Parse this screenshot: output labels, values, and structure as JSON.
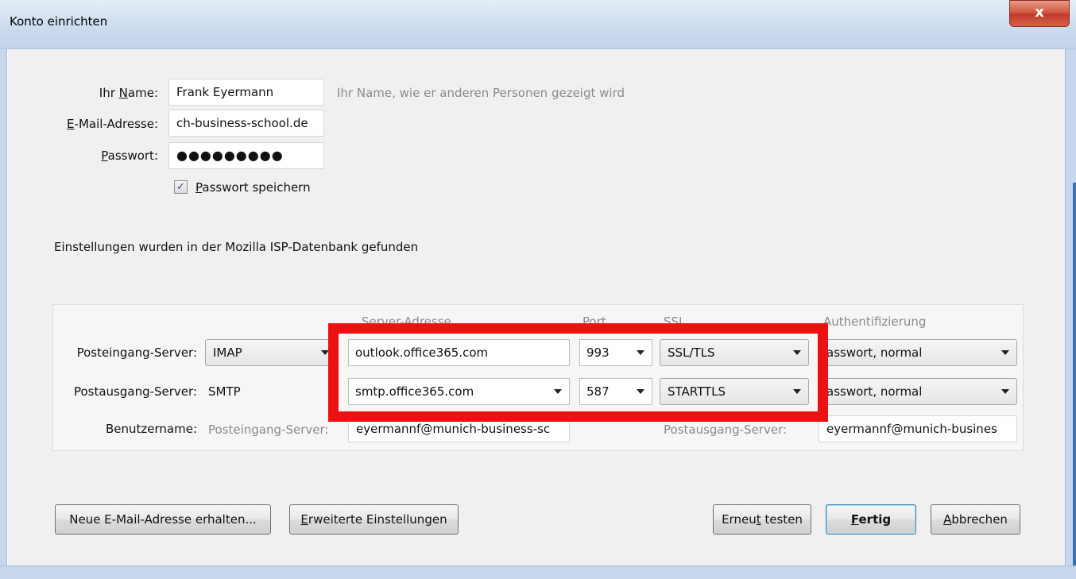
{
  "window": {
    "title": "Konto einrichten",
    "close_glyph": "x"
  },
  "form": {
    "name_label_pre": "Ihr ",
    "name_label_ul": "N",
    "name_label_post": "ame:",
    "name_value": "Frank Eyermann",
    "name_hint": "Ihr Name, wie er anderen Personen gezeigt wird",
    "email_label_ul": "E",
    "email_label_post": "-Mail-Adresse:",
    "email_value": "ch-business-school.de",
    "password_label_ul": "P",
    "password_label_post": "asswort:",
    "password_value": "●●●●●●●●●",
    "save_password_checked": true,
    "save_password_ul": "P",
    "save_password_post": "asswort speichern"
  },
  "status_message": "Einstellungen wurden in der Mozilla ISP-Datenbank gefunden",
  "server_table": {
    "headers": {
      "server_address": "Server-Adresse",
      "port": "Port",
      "ssl": "SSL",
      "auth": "Authentifizierung"
    },
    "incoming": {
      "label": "Posteingang-Server:",
      "protocol": "IMAP",
      "hostname": "outlook.office365.com",
      "port": "993",
      "ssl": "SSL/TLS",
      "auth": "asswort, normal"
    },
    "outgoing": {
      "label": "Postausgang-Server:",
      "protocol": "SMTP",
      "hostname": "smtp.office365.com",
      "port": "587",
      "ssl": "STARTTLS",
      "auth": "asswort, normal"
    },
    "username": {
      "label": "Benutzername:",
      "incoming_label": "Posteingang-Server:",
      "incoming_value": "eyermannf@munich-business-sc",
      "outgoing_label": "Postausgang-Server:",
      "outgoing_value": "eyermannf@munich-busines"
    }
  },
  "buttons": {
    "new_email": "Neue E-Mail-Adresse erhalten...",
    "advanced_ul": "E",
    "advanced_post": "rweiterte Einstellungen",
    "retest_pre": "Erneu",
    "retest_ul": "t",
    "retest_post": " testen",
    "done_ul": "F",
    "done_post": "ertig",
    "cancel_ul": "A",
    "cancel_post": "bbrechen"
  },
  "colors": {
    "highlight_box": "#ee1111",
    "dialog_bg": "#f0f0f0",
    "titlebar": "#cddcee"
  }
}
